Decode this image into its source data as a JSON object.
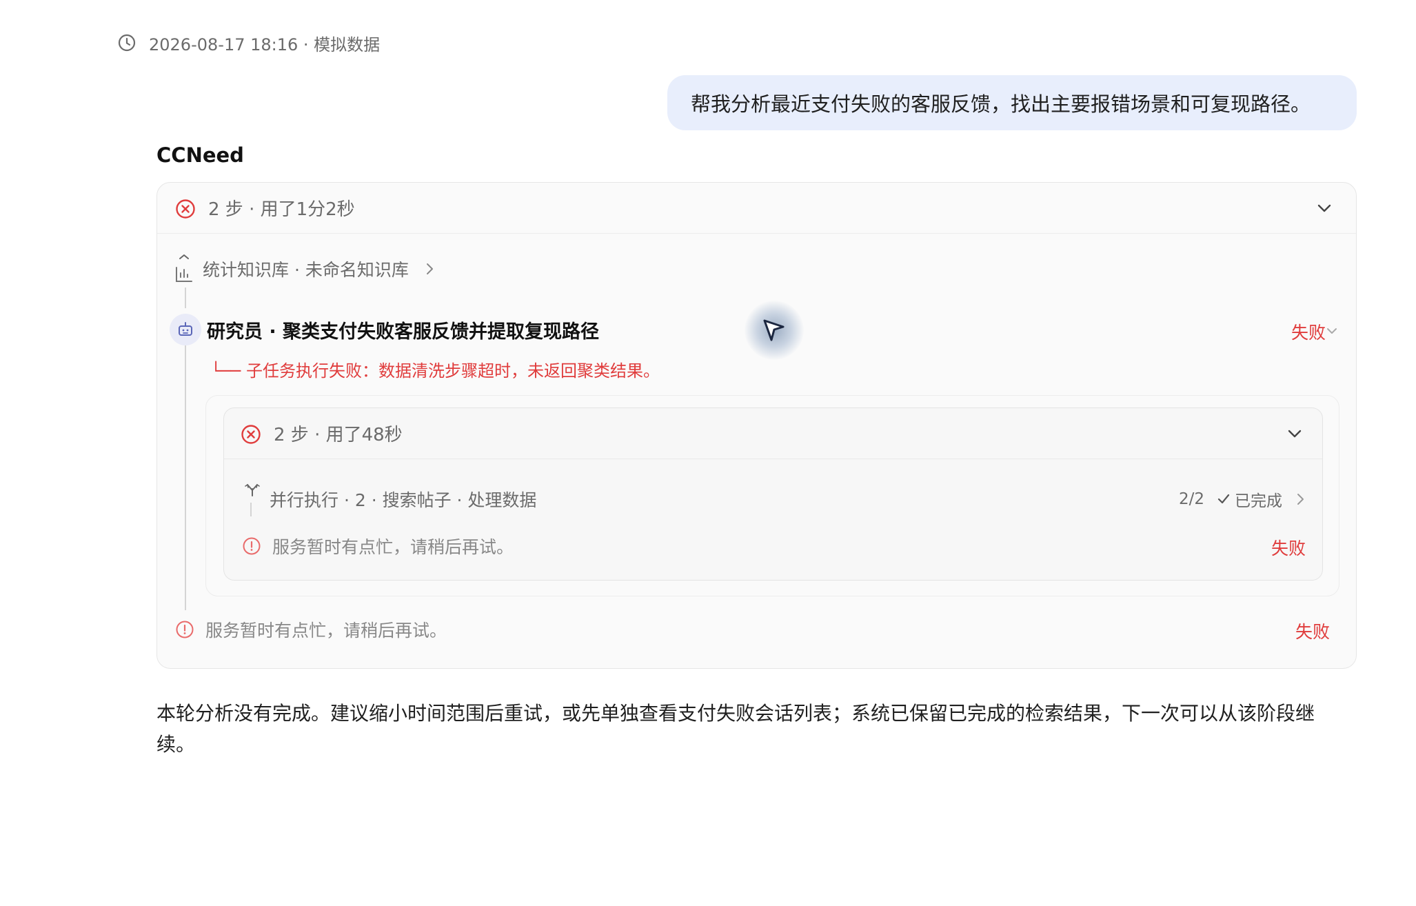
{
  "header": {
    "timestamp_label": "2026-08-17 18:16 · 模拟数据",
    "icon": "clock-icon"
  },
  "user_message": {
    "text": "帮我分析最近支付失败的客服反馈，找出主要报错场景和可复现路径。"
  },
  "assistant": {
    "name": "CCNeed",
    "run": {
      "summary": "2 步 · 用了1分2秒",
      "status_icon": "error-circle-icon",
      "steps": [
        {
          "label": "统计知识库 · 未命名知识库",
          "icon": "bar-chart-icon"
        },
        {
          "label": "研究员 · 聚类支付失败客服反馈并提取复现路径",
          "icon": "robot-icon",
          "status": "失败",
          "error_note": "└── 子任务执行失败：数据清洗步骤超时，未返回聚类结果。",
          "sub_run": {
            "summary": "2 步 · 用了48秒",
            "parallel": {
              "label": "并行执行 · 2 · 搜索帖子 · 处理数据",
              "progress": "2/2",
              "done_label": "已完成"
            },
            "error": {
              "label": "服务暂时有点忙，请稍后再试。",
              "status": "失败"
            }
          }
        }
      ],
      "final_error": {
        "label": "服务暂时有点忙，请稍后再试。",
        "status": "失败"
      }
    },
    "closing_text": "本轮分析没有完成。建议缩小时间范围后重试，或先单独查看支付失败会话列表；系统已保留已完成的检索结果，下一次可以从该阶段继续。"
  },
  "colors": {
    "error": "#e03c3c",
    "bubble_bg": "#e8eefc",
    "robot_bg": "#e9ebf8"
  }
}
